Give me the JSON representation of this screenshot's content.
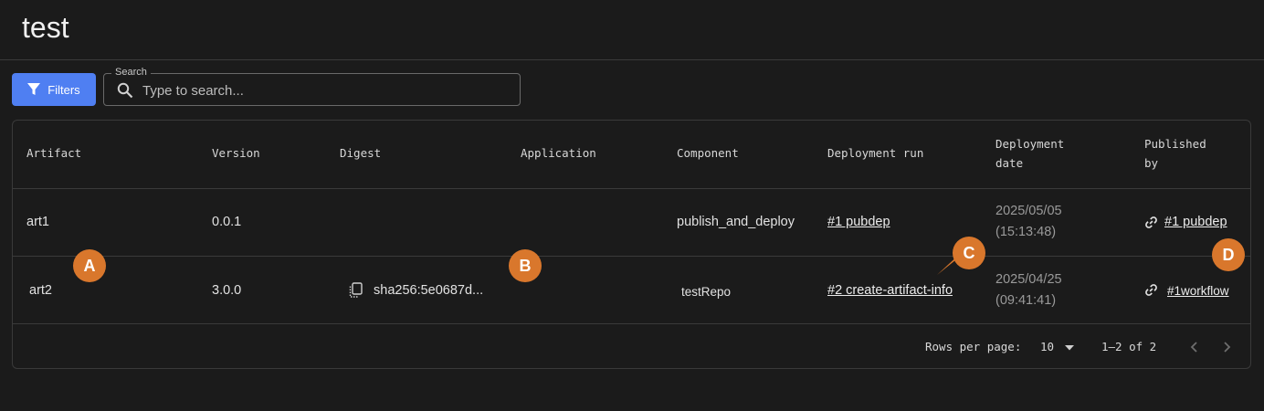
{
  "page": {
    "title": "test"
  },
  "toolbar": {
    "filters_label": "Filters",
    "search_legend": "Search",
    "search_placeholder": "Type to search...",
    "search_value": ""
  },
  "table": {
    "columns": {
      "artifact": "Artifact",
      "version": "Version",
      "digest": "Digest",
      "application": "Application",
      "component": "Component",
      "deployment_run": "Deployment run",
      "deployment_date_1": "Deployment",
      "deployment_date_2": "date",
      "published_by_1": "Published",
      "published_by_2": "by"
    },
    "rows": [
      {
        "artifact": "art1",
        "version": "0.0.1",
        "digest": "",
        "application": "",
        "component": "publish_and_deploy",
        "deployment_run": "#1 pubdep",
        "date": "2025/05/05",
        "time": "(15:13:48)",
        "published_by": "#1 pubdep"
      },
      {
        "artifact": "art2",
        "version": "3.0.0",
        "digest": "sha256:5e0687d...",
        "application": "",
        "component": "testRepo",
        "deployment_run": "#2 create-artifact-info",
        "date": "2025/04/25",
        "time": "(09:41:41)",
        "published_by": "#1workflow"
      }
    ]
  },
  "pagination": {
    "rows_per_page_label": "Rows per page:",
    "rows_per_page_value": "10",
    "range": "1–2 of 2"
  },
  "markers": {
    "a": "A",
    "b": "B",
    "c": "C",
    "d": "D"
  },
  "colors": {
    "accent": "#4f7ff2",
    "marker": "#d9772c",
    "background": "#1b1b1b"
  }
}
